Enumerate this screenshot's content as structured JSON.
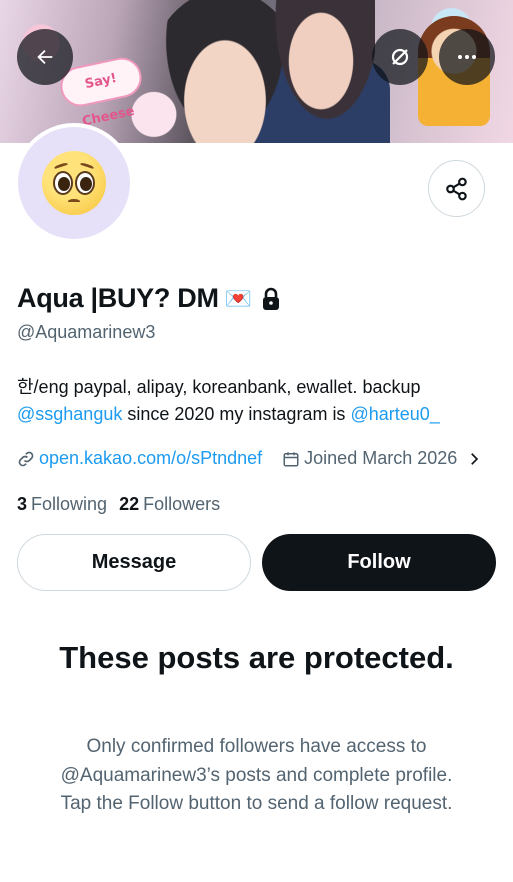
{
  "banner": {
    "sticker_text": "Say! Cheese",
    "back_icon": "arrow-left-icon",
    "sync_icon": "sync-off-icon",
    "more_icon": "more-horizontal-icon"
  },
  "profile": {
    "display_name": "Aqua |BUY? DM",
    "name_emoji": "💌",
    "lock_icon": "lock-icon",
    "handle": "@Aquamarinew3",
    "bio": {
      "part1": "한/eng paypal, alipay, koreanbank, ewallet. backup ",
      "mention1": "@ssghanguk",
      "part2": " since 2020 my instagram is ",
      "mention2": "@harteu0_"
    },
    "website": "open.kakao.com/o/sPtndnef",
    "joined": "Joined March 2026",
    "following_count": "3",
    "following_label": "Following",
    "followers_count": "22",
    "followers_label": "Followers"
  },
  "actions": {
    "message_label": "Message",
    "follow_label": "Follow"
  },
  "protected": {
    "title": "These posts are protected.",
    "description": "Only confirmed followers have access to @Aquamarinew3’s posts and complete profile. Tap the Follow button to send a follow request."
  },
  "colors": {
    "link": "#1d9bf0",
    "text_primary": "#0f1419",
    "text_secondary": "#536471",
    "border": "#cfd9de"
  }
}
